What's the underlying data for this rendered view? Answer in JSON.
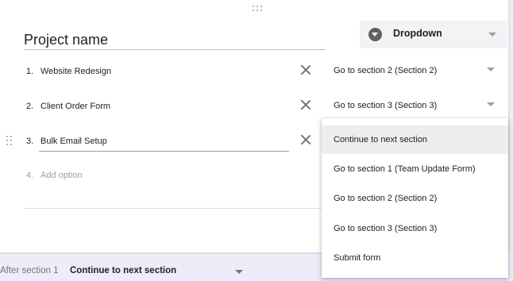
{
  "question": {
    "title": "Project name",
    "type_label": "Dropdown",
    "type_icon": "dropdown-circle-icon"
  },
  "options": [
    {
      "number": "1.",
      "label": "Website Redesign",
      "goto": "Go to section 2 (Section 2)"
    },
    {
      "number": "2.",
      "label": "Client Order Form",
      "goto": "Go to section 3 (Section 3)"
    },
    {
      "number": "3.",
      "label": "Bulk Email Setup"
    }
  ],
  "add_option": {
    "number": "4.",
    "label": "Add option"
  },
  "goto_menu": {
    "items": [
      "Continue to next section",
      "Go to section 1 (Team Update Form)",
      "Go to section 2 (Section 2)",
      "Go to section 3 (Section 3)",
      "Submit form"
    ],
    "selected_index": 0
  },
  "footer": {
    "label": "After section 1",
    "value": "Continue to next section"
  },
  "colors": {
    "background": "#f0ebf8",
    "card": "#ffffff",
    "highlight": "#eeeeee"
  }
}
